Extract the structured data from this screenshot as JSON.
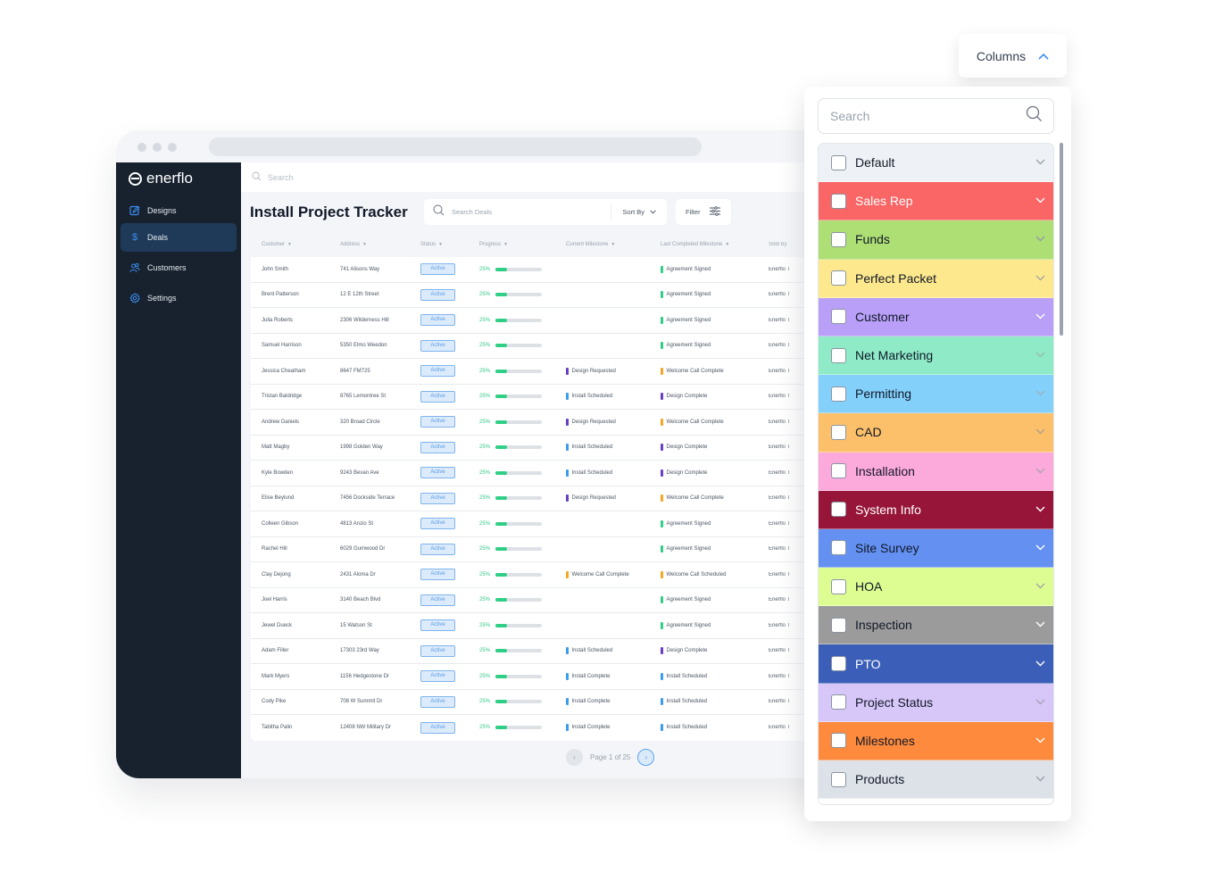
{
  "app": {
    "brand": "enerflo",
    "top_search_placeholder": "Search",
    "page_title": "Install Project Tracker"
  },
  "sidebar": {
    "items": [
      {
        "label": "Designs",
        "icon": "edit-icon",
        "active": false
      },
      {
        "label": "Deals",
        "icon": "dollar-icon",
        "active": true
      },
      {
        "label": "Customers",
        "icon": "users-icon",
        "active": false
      },
      {
        "label": "Settings",
        "icon": "gear-icon",
        "active": false
      }
    ]
  },
  "toolbar": {
    "search_placeholder": "Search Deals",
    "sort_label": "Sort By",
    "filter_label": "Filter"
  },
  "table": {
    "headers": [
      "Customer",
      "Address",
      "Status",
      "Progress",
      "Current Milestone",
      "Last Completed Milestone",
      "Sold By"
    ],
    "rows": [
      {
        "customer": "John Smith",
        "address": "741 Alisons Way",
        "status": "Active",
        "progress": 25,
        "progress_label": "25%",
        "current": "",
        "current_color": "",
        "last": "Agreement Signed",
        "last_color": "#2fcf86",
        "sold_by": "Enerflo T"
      },
      {
        "customer": "Brent Patterson",
        "address": "12 E 12th Street",
        "status": "Active",
        "progress": 25,
        "progress_label": "25%",
        "current": "",
        "current_color": "",
        "last": "Agreement Signed",
        "last_color": "#2fcf86",
        "sold_by": "Enerflo T"
      },
      {
        "customer": "Julia Roberts",
        "address": "2306 Wilderness Hill",
        "status": "Active",
        "progress": 25,
        "progress_label": "25%",
        "current": "",
        "current_color": "",
        "last": "Agreement Signed",
        "last_color": "#2fcf86",
        "sold_by": "Enerflo T"
      },
      {
        "customer": "Samuel Harrison",
        "address": "5350 Elmo Weedon",
        "status": "Active",
        "progress": 25,
        "progress_label": "25%",
        "current": "",
        "current_color": "",
        "last": "Agreement Signed",
        "last_color": "#2fcf86",
        "sold_by": "Enerflo T"
      },
      {
        "customer": "Jessica Cheatham",
        "address": "8647 FM725",
        "status": "Active",
        "progress": 25,
        "progress_label": "25%",
        "current": "Design Requested",
        "current_color": "#6a3fc8",
        "last": "Welcome Call Complete",
        "last_color": "#f5a623",
        "sold_by": "Enerflo T"
      },
      {
        "customer": "Tristan Baldridge",
        "address": "8765 Lemontree St",
        "status": "Active",
        "progress": 25,
        "progress_label": "25%",
        "current": "Install Scheduled",
        "current_color": "#3b9cf0",
        "last": "Design Complete",
        "last_color": "#6a3fc8",
        "sold_by": "Enerflo T"
      },
      {
        "customer": "Andrew Daniels",
        "address": "320 Broad Circle",
        "status": "Active",
        "progress": 25,
        "progress_label": "25%",
        "current": "Design Requested",
        "current_color": "#6a3fc8",
        "last": "Welcome Call Complete",
        "last_color": "#f5a623",
        "sold_by": "Enerflo T"
      },
      {
        "customer": "Matt Magby",
        "address": "1998 Golden Way",
        "status": "Active",
        "progress": 25,
        "progress_label": "25%",
        "current": "Install Scheduled",
        "current_color": "#3b9cf0",
        "last": "Design Complete",
        "last_color": "#6a3fc8",
        "sold_by": "Enerflo T"
      },
      {
        "customer": "Kyle Bowden",
        "address": "9243 Bevan Ave",
        "status": "Active",
        "progress": 25,
        "progress_label": "25%",
        "current": "Install Scheduled",
        "current_color": "#3b9cf0",
        "last": "Design Complete",
        "last_color": "#6a3fc8",
        "sold_by": "Enerflo T"
      },
      {
        "customer": "Elise Beylund",
        "address": "7456 Dockside Terrace",
        "status": "Active",
        "progress": 25,
        "progress_label": "25%",
        "current": "Design Requested",
        "current_color": "#6a3fc8",
        "last": "Welcome Call Complete",
        "last_color": "#f5a623",
        "sold_by": "Enerflo T"
      },
      {
        "customer": "Colleen Gibson",
        "address": "4813 Anzio St",
        "status": "Active",
        "progress": 25,
        "progress_label": "25%",
        "current": "",
        "current_color": "",
        "last": "Agreement Signed",
        "last_color": "#2fcf86",
        "sold_by": "Enerflo T"
      },
      {
        "customer": "Rachel Hill",
        "address": "6029 Gumwood Dr",
        "status": "Active",
        "progress": 25,
        "progress_label": "25%",
        "current": "",
        "current_color": "",
        "last": "Agreement Signed",
        "last_color": "#2fcf86",
        "sold_by": "Enerflo T"
      },
      {
        "customer": "Clay Dejong",
        "address": "2431 Aloma Dr",
        "status": "Active",
        "progress": 25,
        "progress_label": "25%",
        "current": "Welcome Call Complete",
        "current_color": "#f5a623",
        "last": "Welcome Call Scheduled",
        "last_color": "#f5a623",
        "sold_by": "Enerflo T"
      },
      {
        "customer": "Joel Harris",
        "address": "3140  Beach Blvd",
        "status": "Active",
        "progress": 25,
        "progress_label": "25%",
        "current": "",
        "current_color": "",
        "last": "Agreement Signed",
        "last_color": "#2fcf86",
        "sold_by": "Enerflo T"
      },
      {
        "customer": "Jewel Dueck",
        "address": "15 Watson St",
        "status": "Active",
        "progress": 25,
        "progress_label": "25%",
        "current": "",
        "current_color": "",
        "last": "Agreement Signed",
        "last_color": "#2fcf86",
        "sold_by": "Enerflo T"
      },
      {
        "customer": "Adam Filler",
        "address": "17303 23rd Way",
        "status": "Active",
        "progress": 25,
        "progress_label": "25%",
        "current": "Install Scheduled",
        "current_color": "#3b9cf0",
        "last": "Design Complete",
        "last_color": "#6a3fc8",
        "sold_by": "Enerflo T"
      },
      {
        "customer": "Mark Myers",
        "address": "1156 Hedgestone Dr",
        "status": "Active",
        "progress": 25,
        "progress_label": "25%",
        "current": "Install Complete",
        "current_color": "#3b9cf0",
        "last": "Install Scheduled",
        "last_color": "#3b9cf0",
        "sold_by": "Enerflo T"
      },
      {
        "customer": "Cody Pike",
        "address": "708 W Summit Dr",
        "status": "Active",
        "progress": 25,
        "progress_label": "25%",
        "current": "Install Complete",
        "current_color": "#3b9cf0",
        "last": "Install Scheduled",
        "last_color": "#3b9cf0",
        "sold_by": "Enerflo T"
      },
      {
        "customer": "Tabitha Palin",
        "address": "12408 NW Military Dr",
        "status": "Active",
        "progress": 25,
        "progress_label": "25%",
        "current": "Install Complete",
        "current_color": "#3b9cf0",
        "last": "Install Scheduled",
        "last_color": "#3b9cf0",
        "sold_by": "Enerflo T"
      }
    ]
  },
  "pagination": {
    "label": "Page 1 of 25",
    "current_page": 1,
    "total_pages": 25
  },
  "columns_panel": {
    "button_label": "Columns",
    "search_placeholder": "Search",
    "groups": [
      {
        "label": "Default",
        "bg": "#eef1f5",
        "fg": "#111827",
        "chev": "#9aa3ae",
        "checked": false
      },
      {
        "label": "Sales Rep",
        "bg": "#fa6566",
        "fg": "#ffffff",
        "chev": "#ffffff",
        "checked": false
      },
      {
        "label": "Funds",
        "bg": "#addf75",
        "fg": "#111827",
        "chev": "#8fa0a0",
        "checked": false
      },
      {
        "label": "Perfect Packet",
        "bg": "#fde88d",
        "fg": "#111827",
        "chev": "#a8a8a0",
        "checked": false
      },
      {
        "label": "Customer",
        "bg": "#b99ff8",
        "fg": "#111827",
        "chev": "#ffffff",
        "checked": false
      },
      {
        "label": "Net Marketing",
        "bg": "#8eeac7",
        "fg": "#111827",
        "chev": "#9ab8b0",
        "checked": false
      },
      {
        "label": "Permitting",
        "bg": "#83d0fb",
        "fg": "#111827",
        "chev": "#9ab0c0",
        "checked": false
      },
      {
        "label": "CAD",
        "bg": "#fdc06a",
        "fg": "#111827",
        "chev": "#b0a090",
        "checked": false
      },
      {
        "label": "Installation",
        "bg": "#fca9dc",
        "fg": "#111827",
        "chev": "#b0a0b0",
        "checked": false
      },
      {
        "label": "System Info",
        "bg": "#961538",
        "fg": "#ffffff",
        "chev": "#ffffff",
        "checked": false
      },
      {
        "label": "Site Survey",
        "bg": "#6390f1",
        "fg": "#111827",
        "chev": "#ffffff",
        "checked": false
      },
      {
        "label": "HOA",
        "bg": "#ddfd93",
        "fg": "#111827",
        "chev": "#a0a8a0",
        "checked": false
      },
      {
        "label": "Inspection",
        "bg": "#9b9b9b",
        "fg": "#111827",
        "chev": "#ffffff",
        "checked": false
      },
      {
        "label": "PTO",
        "bg": "#3b5fb8",
        "fg": "#ffffff",
        "chev": "#ffffff",
        "checked": false
      },
      {
        "label": "Project Status",
        "bg": "#d7c6f8",
        "fg": "#111827",
        "chev": "#a8a0b8",
        "checked": false
      },
      {
        "label": "Milestones",
        "bg": "#fd8a3d",
        "fg": "#111827",
        "chev": "#ffffff",
        "checked": false
      },
      {
        "label": "Products",
        "bg": "#dde1e8",
        "fg": "#111827",
        "chev": "#9aa3ae",
        "checked": false
      }
    ]
  }
}
